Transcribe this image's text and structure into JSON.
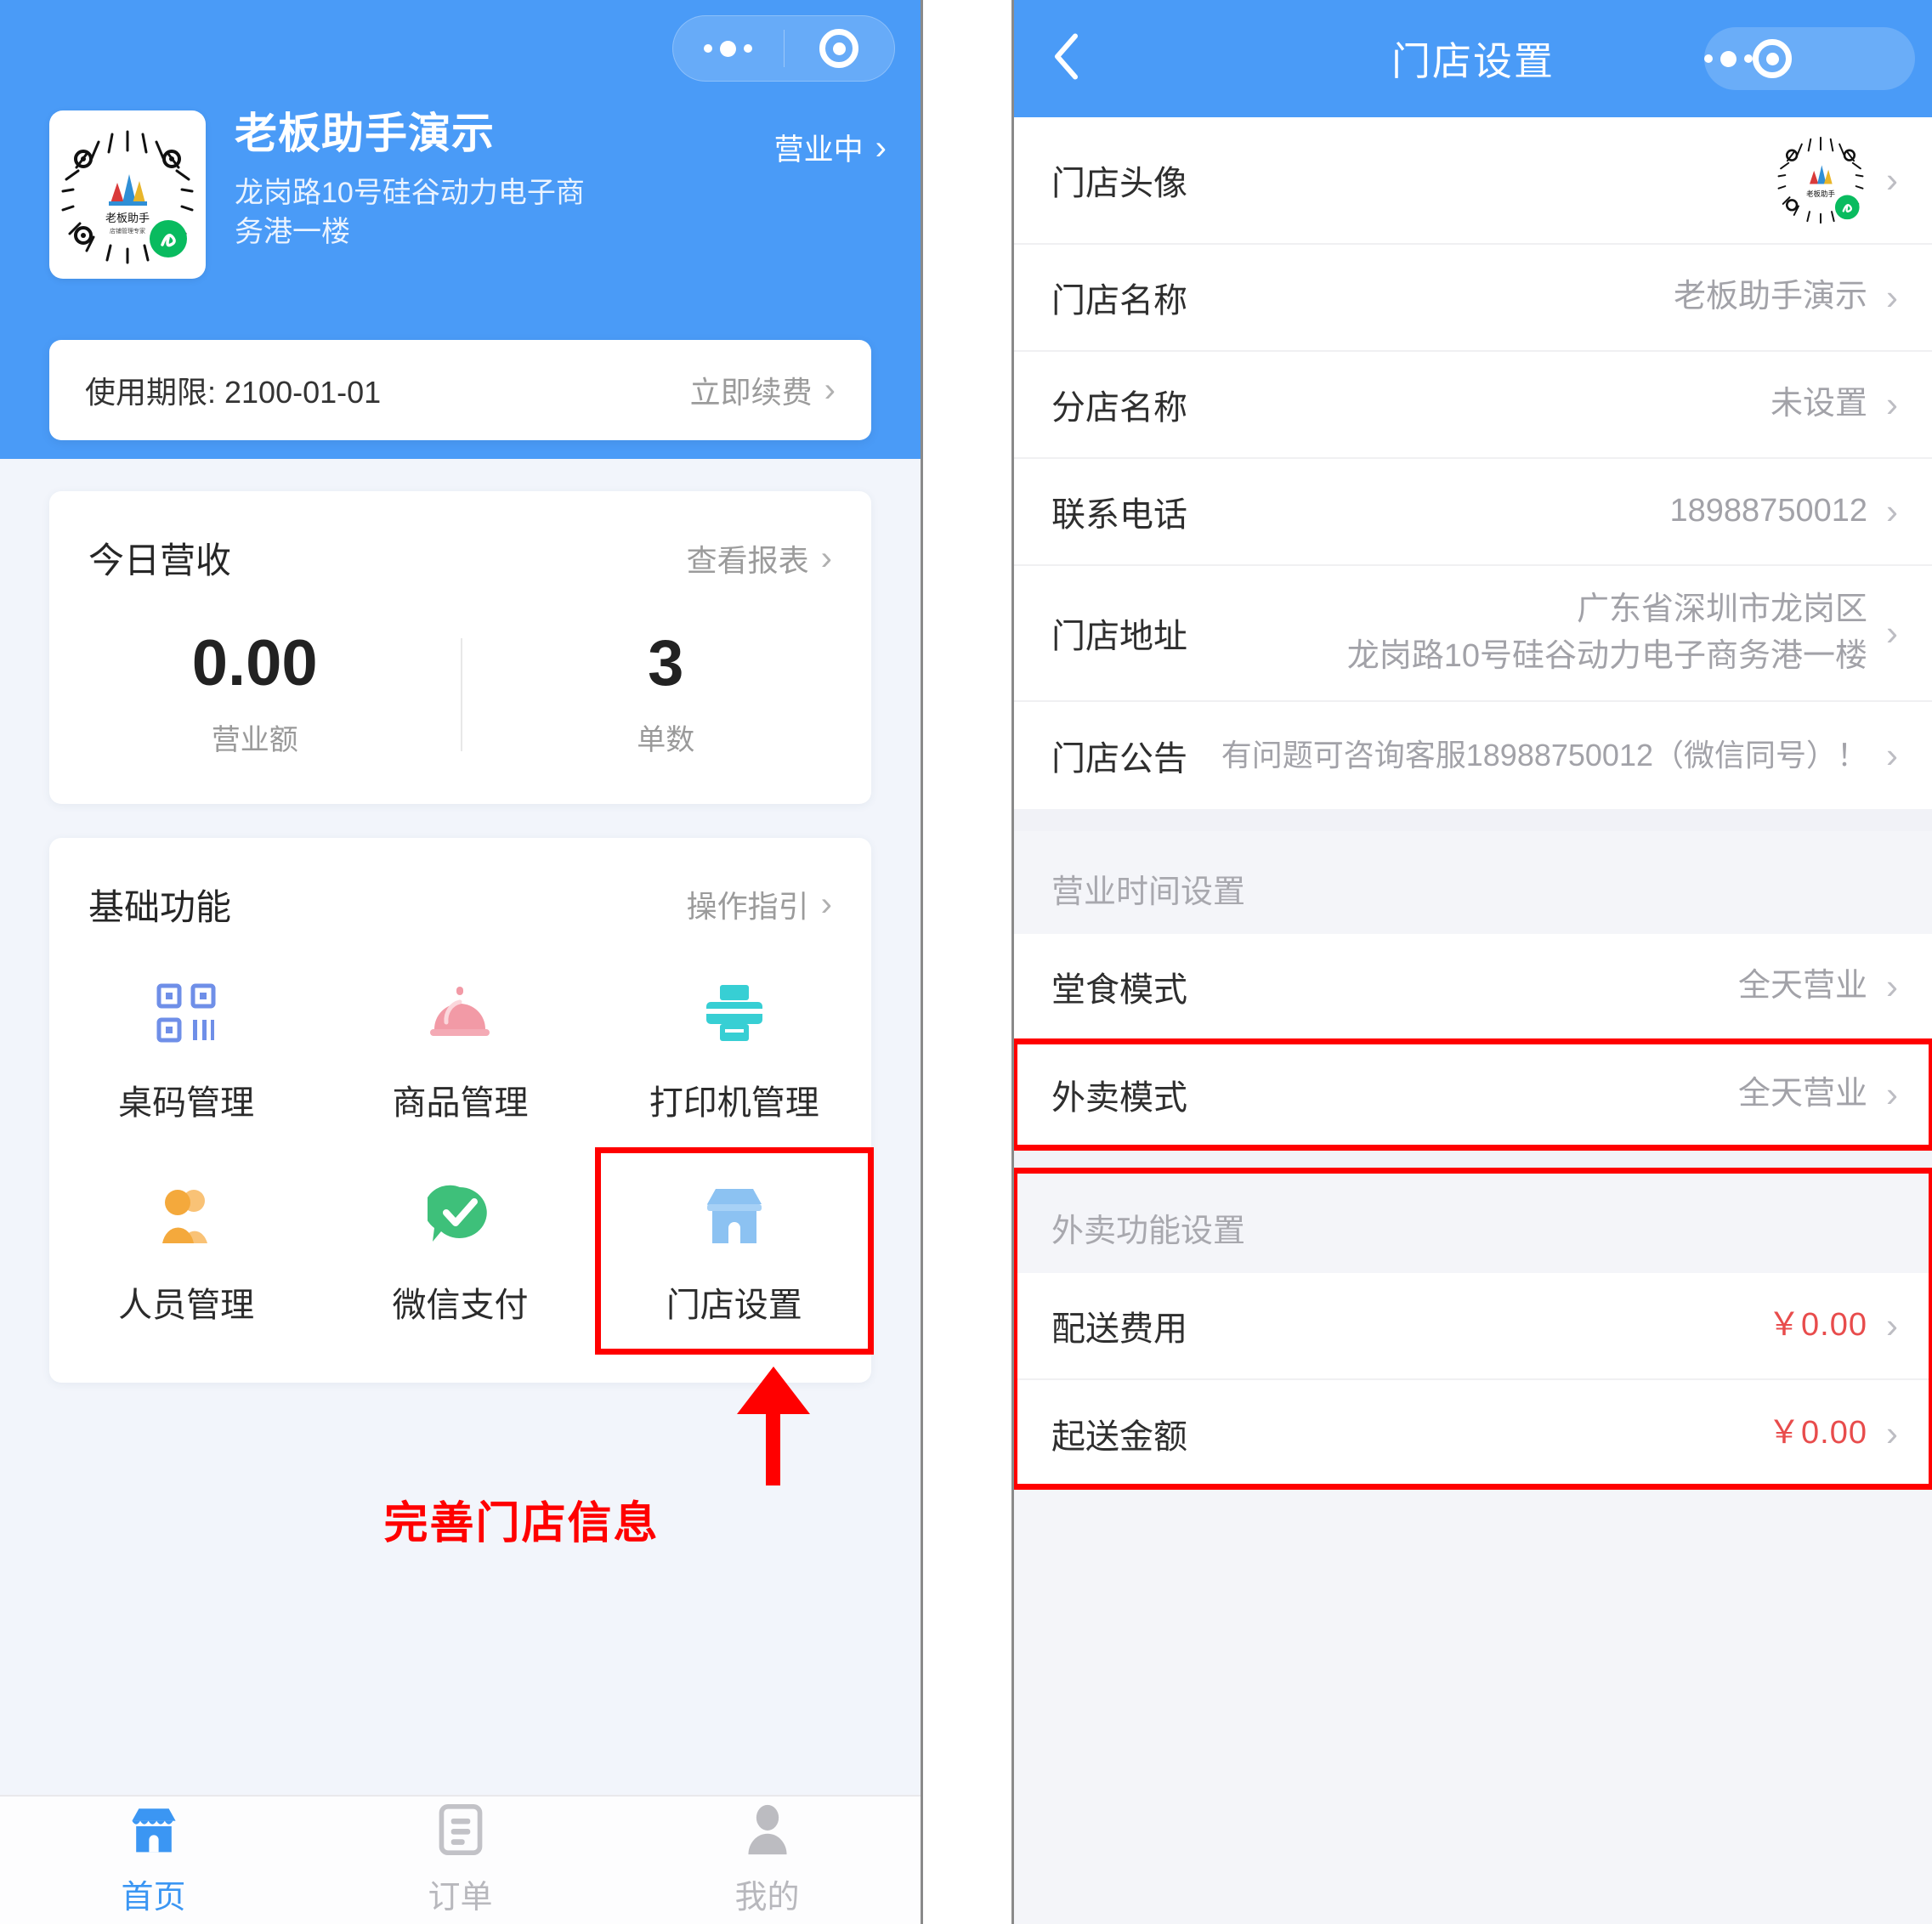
{
  "left_panel": {
    "capsule": {
      "more_icon": "more-dots-icon",
      "target_icon": "target-circle-icon"
    },
    "store": {
      "avatar_icon": "qr-code-logo",
      "name": "老板助手演示",
      "address": "龙岗路10号硅谷动力电子商务港一楼",
      "status": "营业中"
    },
    "license": {
      "label": "使用期限: 2100-01-01",
      "action": "立即续费"
    },
    "revenue": {
      "title": "今日营收",
      "link": "查看报表",
      "stats": [
        {
          "value": "0.00",
          "label": "营业额"
        },
        {
          "value": "3",
          "label": "单数"
        }
      ]
    },
    "functions": {
      "title": "基础功能",
      "link": "操作指引",
      "items": [
        {
          "label": "桌码管理",
          "icon": "qr-table-code-icon",
          "highlight": false
        },
        {
          "label": "商品管理",
          "icon": "bell-dish-icon",
          "highlight": false
        },
        {
          "label": "打印机管理",
          "icon": "printer-icon",
          "highlight": false
        },
        {
          "label": "人员管理",
          "icon": "people-icon",
          "highlight": false
        },
        {
          "label": "微信支付",
          "icon": "wechat-pay-check-icon",
          "highlight": false
        },
        {
          "label": "门店设置",
          "icon": "storefront-icon",
          "highlight": true
        }
      ]
    },
    "annotation": {
      "text": "完善门店信息",
      "color": "#ff0000",
      "arrow_icon": "up-arrow-annotation"
    },
    "tabbar": [
      {
        "label": "首页",
        "icon": "storefront-icon",
        "active": true
      },
      {
        "label": "订单",
        "icon": "order-list-icon",
        "active": false
      },
      {
        "label": "我的",
        "icon": "person-icon",
        "active": false
      }
    ]
  },
  "right_panel": {
    "nav": {
      "back_icon": "chevron-left-icon",
      "title": "门店设置",
      "more_icon": "more-dots-icon",
      "target_icon": "target-circle-icon"
    },
    "store_info_rows": [
      {
        "label": "门店头像",
        "value": "",
        "type": "avatar",
        "highlight": false
      },
      {
        "label": "门店名称",
        "value": "老板助手演示",
        "type": "text",
        "highlight": false
      },
      {
        "label": "分店名称",
        "value": "未设置",
        "type": "text",
        "highlight": false
      },
      {
        "label": "联系电话",
        "value": "18988750012",
        "type": "text",
        "highlight": false
      },
      {
        "label": "门店地址",
        "value": "广东省深圳市龙岗区\n龙岗路10号硅谷动力电子商务港一楼",
        "type": "address",
        "highlight": false
      },
      {
        "label": "门店公告",
        "value": "有问题可咨询客服18988750012（微信同号）！",
        "type": "notice",
        "highlight": false
      }
    ],
    "hours_section": {
      "header": "营业时间设置",
      "rows": [
        {
          "label": "堂食模式",
          "value": "全天营业",
          "highlight": false
        },
        {
          "label": "外卖模式",
          "value": "全天营业",
          "highlight": true
        }
      ]
    },
    "delivery_section": {
      "header": "外卖功能设置",
      "highlight": true,
      "rows": [
        {
          "label": "配送费用",
          "value": "￥0.00",
          "price": true
        },
        {
          "label": "起送金额",
          "value": "￥0.00",
          "price": true
        }
      ]
    }
  },
  "colors": {
    "brand_blue": "#4a9bf7",
    "annotation_red": "#ff0000",
    "price_red": "#e84c4c",
    "page_bg": "#f4f5f9"
  }
}
